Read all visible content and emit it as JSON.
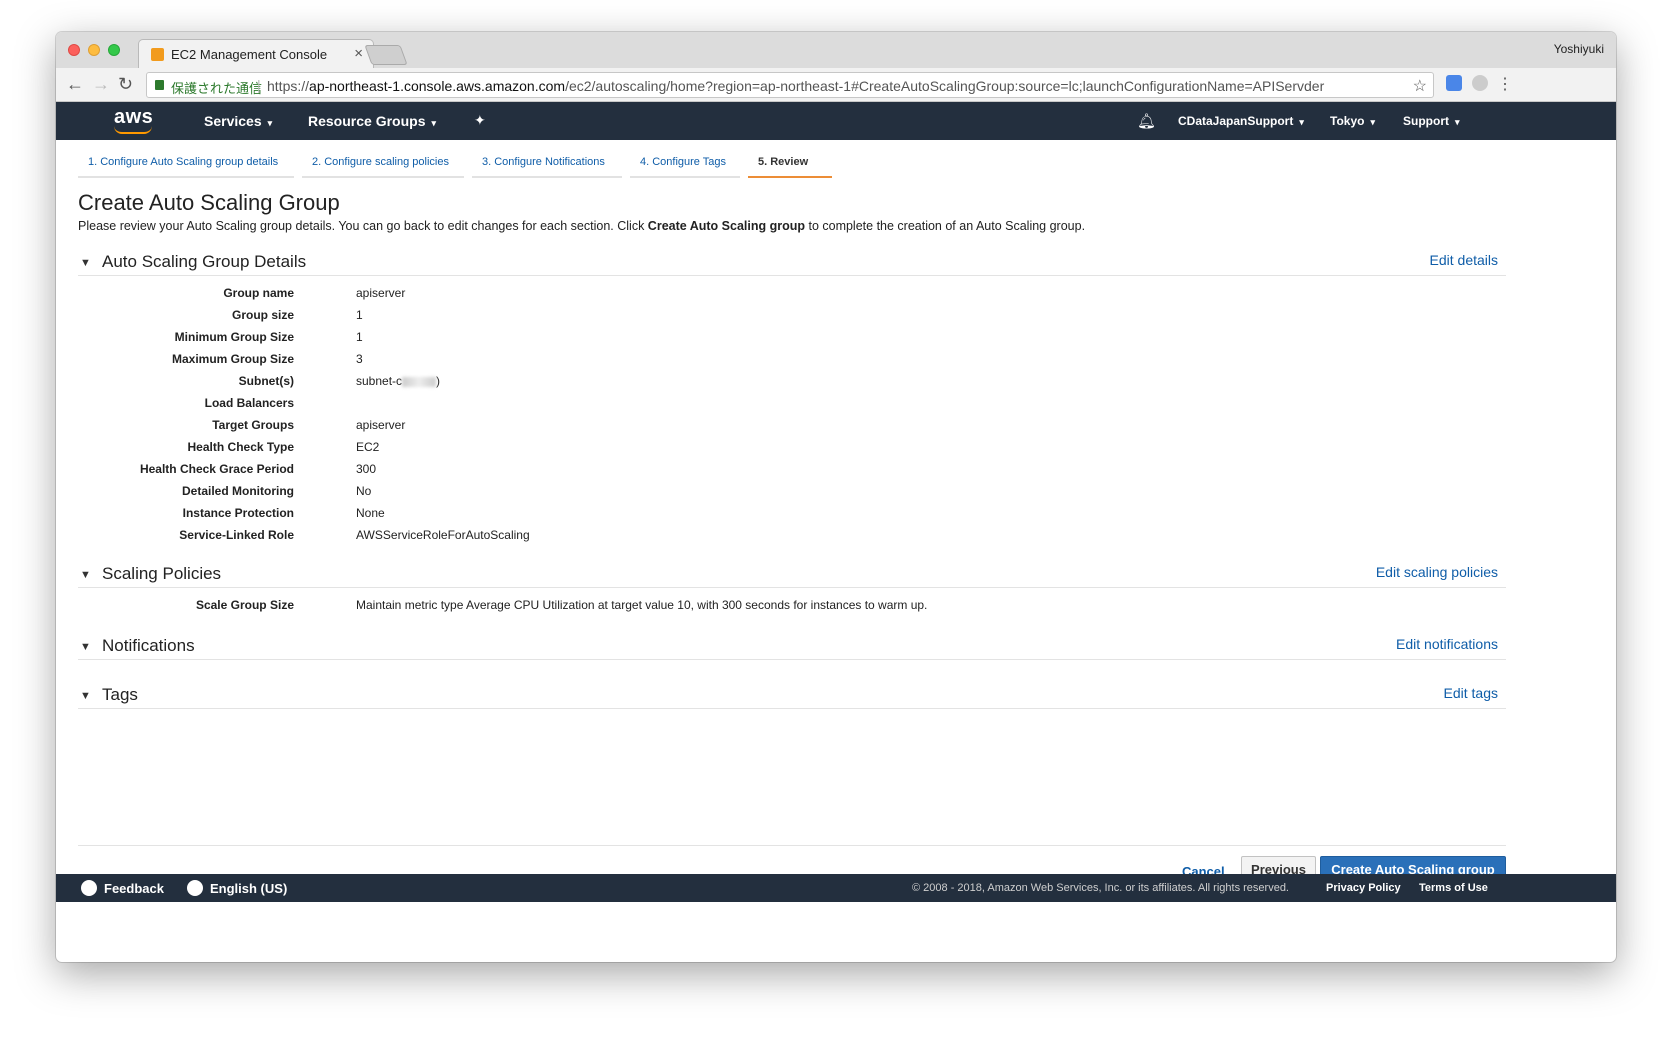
{
  "browser": {
    "tab_title": "EC2 Management Console",
    "tab_close": "×",
    "profile_name": "Yoshiyuki",
    "secure_label": "保護された通信",
    "url_scheme": "https://",
    "url_host": "ap-northeast-1.console.aws.amazon.com",
    "url_path": "/ec2/autoscaling/home?region=ap-northeast-1#CreateAutoScalingGroup:source=lc;launchConfigurationName=APIServder"
  },
  "aws_header": {
    "logo": "aws",
    "services": "Services",
    "resource_groups": "Resource Groups",
    "account": "CDataJapanSupport",
    "region": "Tokyo",
    "support": "Support"
  },
  "wizard": {
    "steps": [
      "1. Configure Auto Scaling group details",
      "2. Configure scaling policies",
      "3. Configure Notifications",
      "4. Configure Tags",
      "5. Review"
    ],
    "active_step": 5
  },
  "page": {
    "title": "Create Auto Scaling Group",
    "intro_prefix": "Please review your Auto Scaling group details. You can go back to edit changes for each section. Click ",
    "intro_bold": "Create Auto Scaling group",
    "intro_suffix": " to complete the creation of an Auto Scaling group."
  },
  "sections": {
    "details": {
      "title": "Auto Scaling Group Details",
      "edit": "Edit details",
      "rows": [
        {
          "key": "Group name",
          "value": "apiserver"
        },
        {
          "key": "Group size",
          "value": "1"
        },
        {
          "key": "Minimum Group Size",
          "value": "1"
        },
        {
          "key": "Maximum Group Size",
          "value": "3"
        },
        {
          "key": "Subnet(s)",
          "value": "subnet-c"
        },
        {
          "key": "Load Balancers",
          "value": ""
        },
        {
          "key": "Target Groups",
          "value": "apiserver"
        },
        {
          "key": "Health Check Type",
          "value": "EC2"
        },
        {
          "key": "Health Check Grace Period",
          "value": "300"
        },
        {
          "key": "Detailed Monitoring",
          "value": "No"
        },
        {
          "key": "Instance Protection",
          "value": "None"
        },
        {
          "key": "Service-Linked Role",
          "value": "AWSServiceRoleForAutoScaling"
        }
      ],
      "subnet_suffix": ")"
    },
    "scaling": {
      "title": "Scaling Policies",
      "edit": "Edit scaling policies",
      "rows": [
        {
          "key": "Scale Group Size",
          "value": "Maintain metric type Average CPU Utilization at target value 10, with 300 seconds for instances to warm up."
        }
      ]
    },
    "notifications": {
      "title": "Notifications",
      "edit": "Edit notifications"
    },
    "tags": {
      "title": "Tags",
      "edit": "Edit tags"
    }
  },
  "actions": {
    "cancel": "Cancel",
    "previous": "Previous",
    "create": "Create Auto Scaling group"
  },
  "footer": {
    "feedback": "Feedback",
    "language": "English (US)",
    "copyright": "© 2008 - 2018, Amazon Web Services, Inc. or its affiliates. All rights reserved.",
    "privacy": "Privacy Policy",
    "terms": "Terms of Use"
  },
  "colors": {
    "aws_navy": "#232f3e",
    "link_blue": "#0f5da8",
    "primary_button": "#2a70b9",
    "active_step_accent": "#ec8d36",
    "aws_orange": "#ff9900"
  }
}
